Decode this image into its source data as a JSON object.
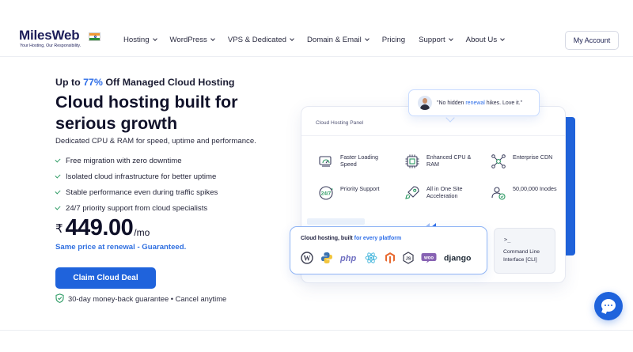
{
  "brand": {
    "name": "MilesWeb",
    "tagline": "Your Hosting, Our Responsibility."
  },
  "nav": {
    "items": [
      {
        "label": "Hosting",
        "has_dropdown": true
      },
      {
        "label": "WordPress",
        "has_dropdown": true
      },
      {
        "label": "VPS & Dedicated",
        "has_dropdown": true
      },
      {
        "label": "Domain & Email",
        "has_dropdown": true
      },
      {
        "label": "Pricing",
        "has_dropdown": false
      },
      {
        "label": "Support",
        "has_dropdown": true
      },
      {
        "label": "About Us",
        "has_dropdown": true
      }
    ],
    "account_label": "My Account"
  },
  "hero": {
    "promo_prefix": "Up to ",
    "promo_discount": "77%",
    "promo_suffix": " Off Managed Cloud Hosting",
    "title": "Cloud hosting built for serious growth",
    "subtitle": "Dedicated CPU & RAM for speed, uptime and performance.",
    "features": [
      "Free migration with zero downtime",
      "Isolated cloud infrastructure for better uptime",
      "Stable performance even during traffic spikes",
      "24/7 priority support from cloud specialists"
    ],
    "currency": "₹",
    "price": "449.00",
    "period": "/mo",
    "renewal_note": "Same price at renewal - Guaranteed.",
    "cta_label": "Claim Cloud Deal",
    "guarantee": "30-day money-back guarantee • Cancel anytime"
  },
  "panel": {
    "title": "Cloud Hosting Panel",
    "features": [
      {
        "icon": "speed-icon",
        "label": "Faster Loading Speed"
      },
      {
        "icon": "cpu-icon",
        "label": "Enhanced CPU & RAM"
      },
      {
        "icon": "cdn-icon",
        "label": "Enterprise CDN"
      },
      {
        "icon": "support-icon",
        "label": "Priority Support"
      },
      {
        "icon": "rocket-icon",
        "label": "All in One Site Acceleration"
      },
      {
        "icon": "inodes-icon",
        "label": "50,00,000 Inodes"
      }
    ]
  },
  "review": {
    "quote_before": "\"No hidden ",
    "quote_accent": "renewal",
    "quote_after": " hikes. Love it.\""
  },
  "platforms": {
    "title_before": "Cloud hosting, built ",
    "title_accent": "for every platform",
    "items": [
      "wordpress-icon",
      "python-icon",
      "php",
      "react-icon",
      "magento-icon",
      "nodejs-icon",
      "woo",
      "django"
    ]
  },
  "cli": {
    "prompt": ">_",
    "label": "Command Line Interface [CLI]"
  },
  "colors": {
    "accent": "#1f63dc",
    "accent_text": "#2e6ee8",
    "check": "#2c9a63"
  }
}
